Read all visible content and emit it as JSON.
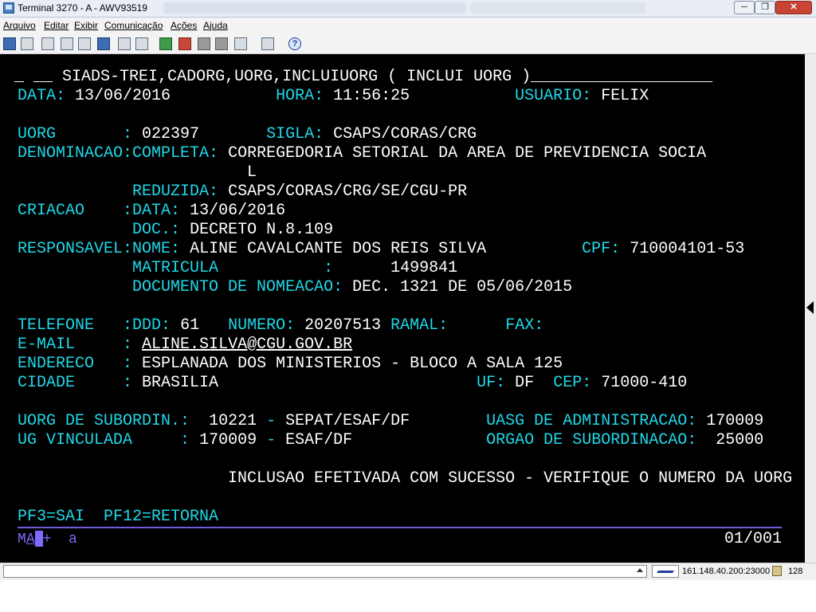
{
  "window": {
    "title": "Terminal 3270 - A - AWV93519"
  },
  "menu": {
    "arquivo": "Arquivo",
    "editar": "Editar",
    "exibir": "Exibir",
    "comunicacao": "Comunicação",
    "acoes": "Ações",
    "ajuda": "Ajuda"
  },
  "toolbar_icons": [
    "print-icon",
    "print-screen-icon",
    "cut-icon",
    "copy-icon",
    "paste-icon",
    "select-icon",
    "macro-icon",
    "keypad-icon",
    "send-icon",
    "receive-icon",
    "transfer-icon",
    "disconnect-icon",
    "settings-icon",
    "help-icon"
  ],
  "screen": {
    "header_cursor": "_",
    "header_title": "__ SIADS-TREI,CADORG,UORG,INCLUIUORG ( INCLUI UORG )___________________",
    "data_label": "DATA:",
    "data_value": "13/06/2016",
    "hora_label": "HORA:",
    "hora_value": "11:56:25",
    "usuario_label": "USUARIO:",
    "usuario_value": "FELIX",
    "uorg_label": "UORG       :",
    "uorg_value": "022397",
    "sigla_label": "SIGLA:",
    "sigla_value": "CSAPS/CORAS/CRG",
    "denominacao_label": "DENOMINACAO:",
    "completa_label": "COMPLETA:",
    "completa_value_1": "CORREGEDORIA SETORIAL DA AREA DE PREVIDENCIA SOCIA",
    "completa_value_2": "L",
    "reduzida_label": "REDUZIDA:",
    "reduzida_value": "CSAPS/CORAS/CRG/SE/CGU-PR",
    "criacao_label": "CRIACAO    :",
    "criacao_data_label": "DATA:",
    "criacao_data_value": "13/06/2016",
    "doc_label": "DOC.:",
    "doc_value": "DECRETO N.8.109",
    "responsavel_label": "RESPONSAVEL:",
    "nome_label": "NOME:",
    "nome_value": "ALINE CAVALCANTE DOS REIS SILVA",
    "cpf_label": "CPF:",
    "cpf_value": "710004101-53",
    "matricula_label": "MATRICULA           :",
    "matricula_value": "1499841",
    "doc_nomeacao_label": "DOCUMENTO DE NOMEACAO:",
    "doc_nomeacao_value": "DEC. 1321 DE 05/06/2015",
    "telefone_label": "TELEFONE   :",
    "ddd_label": "DDD:",
    "ddd_value": "61",
    "numero_label": "NUMERO:",
    "numero_value": "20207513",
    "ramal_label": "RAMAL:",
    "fax_label": "FAX:",
    "email_label": "E-MAIL     :",
    "email_value": "ALINE.SILVA@CGU.GOV.BR",
    "endereco_label": "ENDERECO   :",
    "endereco_value": "ESPLANADA DOS MINISTERIOS - BLOCO A SALA 125",
    "cidade_label": "CIDADE     :",
    "cidade_value": "BRASILIA",
    "uf_label": "UF:",
    "uf_value": "DF",
    "cep_label": "CEP:",
    "cep_value": "71000-410",
    "uorg_subordin_label": "UORG DE SUBORDIN.:",
    "uorg_subordin_code": "10221",
    "uorg_subordin_dash": "-",
    "uorg_subordin_name": "SEPAT/ESAF/DF",
    "uasg_label": "UASG DE ADMINISTRACAO:",
    "uasg_value": "170009",
    "ug_vinculada_label": "UG VINCULADA     :",
    "ug_vinculada_code": "170009",
    "ug_vinculada_dash": "-",
    "ug_vinculada_name": "ESAF/DF",
    "orgao_label": "ORGAO DE SUBORDINACAO:",
    "orgao_value": "25000",
    "message": "INCLUSAO EFETIVADA COM SUCESSO - VERIFIQUE O NUMERO DA UORG",
    "pf3": "PF3=SAI",
    "pf12": "PF12=RETORNA",
    "status_mode_1": "M",
    "status_mode_2": "A",
    "status_plus": "+",
    "status_a": "a",
    "status_page": "01/001"
  },
  "statusbar": {
    "host": "161.148.40.200:23000",
    "bits": "128"
  },
  "colors": {
    "terminal_bg": "#000000",
    "field_label": "#1fd8e8",
    "field_value": "#ffffff",
    "separator": "#6f5cd8"
  }
}
